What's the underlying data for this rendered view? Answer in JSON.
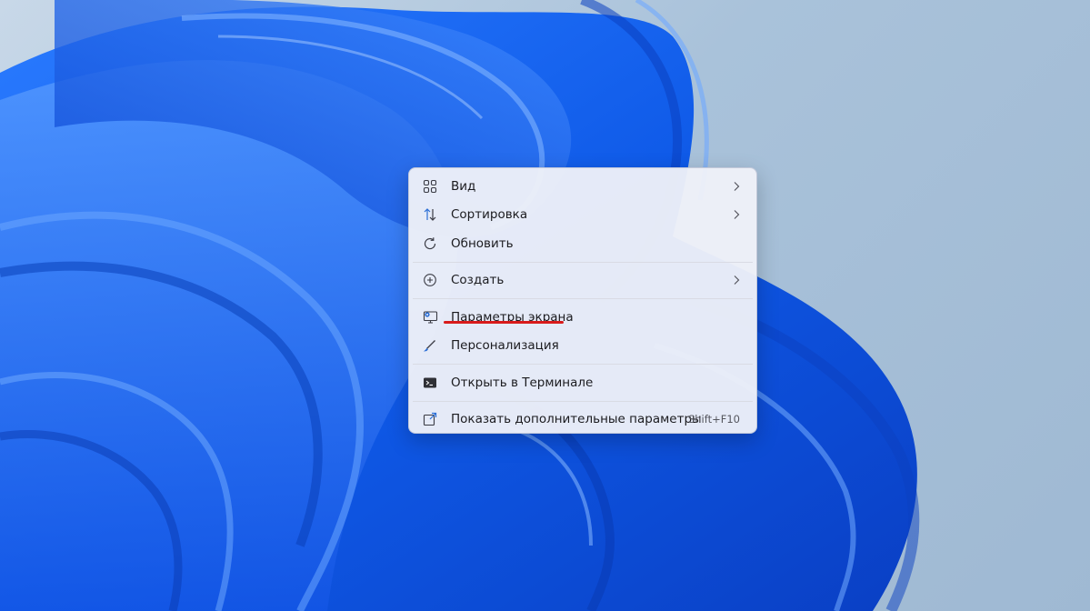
{
  "context_menu": {
    "items": [
      {
        "label": "Вид",
        "icon": "grid-icon",
        "submenu": true
      },
      {
        "label": "Сортировка",
        "icon": "sort-arrows-icon",
        "submenu": true
      },
      {
        "label": "Обновить",
        "icon": "refresh-icon",
        "submenu": false
      },
      {
        "label": "Создать",
        "icon": "plus-circle-icon",
        "submenu": true
      },
      {
        "label": "Параметры экрана",
        "icon": "display-settings-icon",
        "submenu": false,
        "highlighted_with_red_underline": true
      },
      {
        "label": "Персонализация",
        "icon": "pen-brush-icon",
        "submenu": false
      },
      {
        "label": "Открыть в Терминале",
        "icon": "terminal-icon",
        "submenu": false
      },
      {
        "label": "Показать дополнительные параметры",
        "icon": "share-more-icon",
        "submenu": false,
        "shortcut": "Shift+F10"
      }
    ]
  },
  "colors": {
    "annotation_underline": "#d81b1b",
    "menu_background": "#eef0f8",
    "wallpaper_blue": "#1565f0"
  }
}
